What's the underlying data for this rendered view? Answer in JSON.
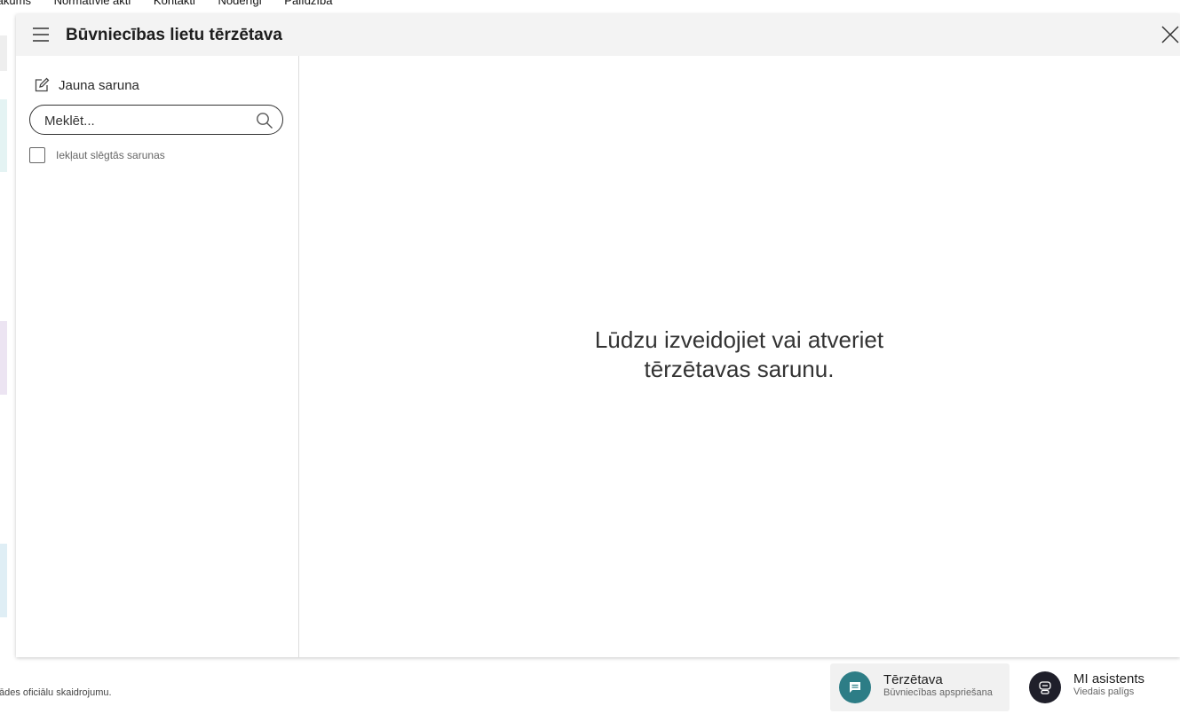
{
  "background": {
    "nav_items": [
      "Sākums",
      "Normatīvie akti",
      "Kontakti",
      "Noderīgi",
      "Palīdzība"
    ],
    "footer_text": "ādes oficiālu skaidrojumu."
  },
  "modal": {
    "title": "Būvniecības lietu tērzētava",
    "new_conversation_label": "Jauna saruna",
    "search_placeholder": "Meklēt...",
    "include_closed_label": "Iekļaut slēgtās sarunas",
    "include_closed_checked": false,
    "empty_message_line1": "Lūdzu izveidojiet vai atveriet",
    "empty_message_line2": "tērzētavas sarunu."
  },
  "widgets": {
    "chat": {
      "title": "Tērzētava",
      "subtitle": "Būvniecības apspriešana",
      "color": "#2d7d86",
      "icon": "chat-bubble-icon"
    },
    "ai": {
      "title": "MI asistents",
      "subtitle": "Viedais palīgs",
      "color": "#1f1f2a",
      "icon": "robot-icon"
    }
  }
}
